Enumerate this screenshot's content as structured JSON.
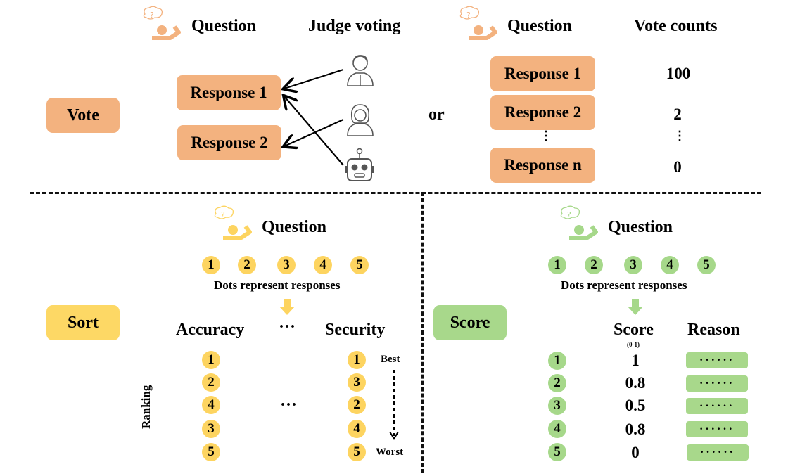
{
  "vote_section": {
    "label": "Vote",
    "left": {
      "question_header": "Question",
      "judge_header": "Judge voting",
      "responses": [
        "Response 1",
        "Response 2"
      ],
      "judges": [
        {
          "icon": "man-judge-icon",
          "votes_for": "Response 1"
        },
        {
          "icon": "woman-judge-icon",
          "votes_for": "Response 2"
        },
        {
          "icon": "robot-judge-icon",
          "votes_for": "Response 1"
        }
      ]
    },
    "or_label": "or",
    "right": {
      "question_header": "Question",
      "counts_header": "Vote counts",
      "rows": [
        {
          "response": "Response 1",
          "count": "100"
        },
        {
          "response": "Response 2",
          "count": "2"
        },
        {
          "response": "Response n",
          "count": "0"
        }
      ],
      "ellipsis": "⋮"
    },
    "color": "#f3b27f"
  },
  "sort_section": {
    "label": "Sort",
    "question_header": "Question",
    "dots": [
      "1",
      "2",
      "3",
      "4",
      "5"
    ],
    "caption": "Dots represent responses",
    "columns": [
      {
        "header": "Accuracy",
        "ranking": [
          "1",
          "2",
          "4",
          "3",
          "5"
        ]
      },
      {
        "header": "Security",
        "ranking": [
          "1",
          "3",
          "2",
          "4",
          "5"
        ]
      }
    ],
    "header_ellipsis": "···",
    "middle_ellipsis": "···",
    "axis_label": "Ranking",
    "best_label": "Best",
    "worst_label": "Worst",
    "color": "#fdd865"
  },
  "score_section": {
    "label": "Score",
    "question_header": "Question",
    "dots": [
      "1",
      "2",
      "3",
      "4",
      "5"
    ],
    "caption": "Dots represent responses",
    "score_header": "Score",
    "score_range": "(0-1)",
    "reason_header": "Reason",
    "rows": [
      {
        "response": "1",
        "score": "1",
        "reason": "······"
      },
      {
        "response": "2",
        "score": "0.8",
        "reason": "······"
      },
      {
        "response": "3",
        "score": "0.5",
        "reason": "······"
      },
      {
        "response": "4",
        "score": "0.8",
        "reason": "······"
      },
      {
        "response": "5",
        "score": "0",
        "reason": "······"
      }
    ],
    "color": "#a8d88b"
  }
}
